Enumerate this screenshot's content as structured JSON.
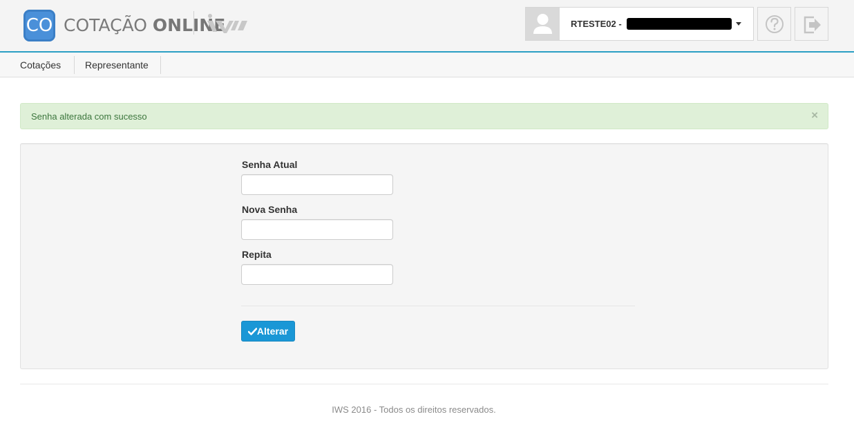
{
  "header": {
    "logo_initials": "CO",
    "logo_word1": "COTAÇÃO",
    "logo_word2": "ONLINE",
    "brand_icon": "iws-brand-mark",
    "user_label": "RTESTE02 -",
    "user_icon": "user-avatar-icon",
    "help_icon": "question-circle-icon",
    "logout_icon": "sign-out-icon"
  },
  "nav": {
    "items": [
      {
        "label": "Cotações"
      },
      {
        "label": "Representante"
      }
    ]
  },
  "alert": {
    "message": "Senha alterada com sucesso",
    "close": "×"
  },
  "form": {
    "fields": [
      {
        "label": "Senha Atual",
        "value": ""
      },
      {
        "label": "Nova Senha",
        "value": ""
      },
      {
        "label": "Repita",
        "value": ""
      }
    ],
    "submit_label": "Alterar",
    "submit_icon": "check-icon"
  },
  "footer": {
    "text": "IWS 2016 - Todos os direitos reservados."
  },
  "colors": {
    "accent": "#1a97d6",
    "header_border": "#2a9fc4",
    "success_bg": "#dff0d8",
    "success_text": "#3c763d"
  }
}
